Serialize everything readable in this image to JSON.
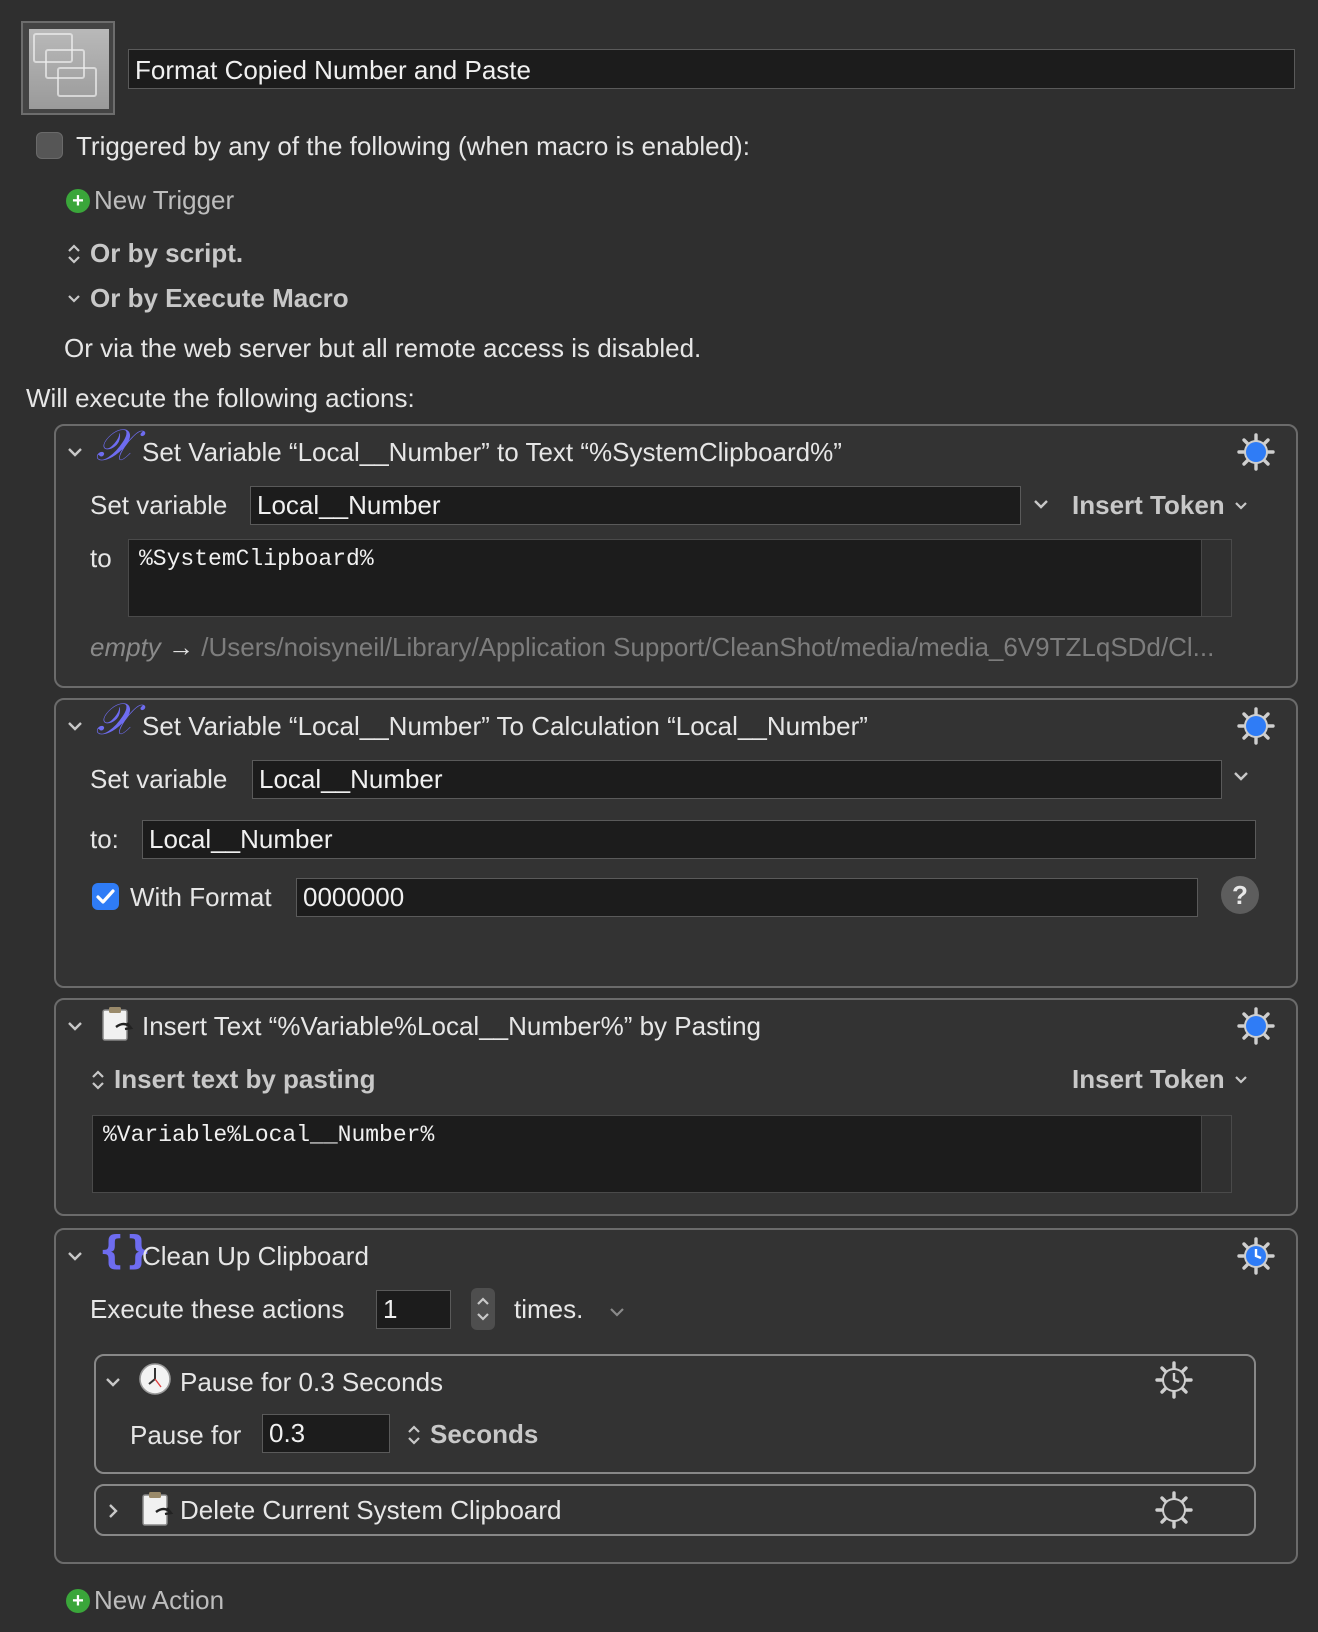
{
  "macro": {
    "name": "Format Copied Number and Paste",
    "trigger_label": "Triggered by any of the following (when macro is enabled):",
    "new_trigger": "New Trigger",
    "or_by_script": "Or by script.",
    "or_by_execute_macro": "Or by Execute Macro",
    "web_server_note": "Or via the web server but all remote access is disabled.",
    "will_execute": "Will execute the following actions:",
    "new_action": "New Action"
  },
  "actions": {
    "a1": {
      "title": "Set Variable “Local__Number” to Text “%SystemClipboard%”",
      "set_variable_label": "Set variable",
      "variable_value": "Local__Number",
      "insert_token": "Insert Token",
      "to_label": "to",
      "text_value": "%SystemClipboard%",
      "preview_empty": "empty",
      "preview_arrow": "→",
      "preview_path": "/Users/noisyneil/Library/Application Support/CleanShot/media/media_6V9TZLqSDd/Cl..."
    },
    "a2": {
      "title": "Set Variable “Local__Number” To Calculation “Local__Number”",
      "set_variable_label": "Set variable",
      "variable_value": "Local__Number",
      "to_label": "to:",
      "calc_value": "Local__Number",
      "with_format_label": "With Format",
      "with_format_checked": true,
      "format_value": "0000000",
      "help": "?"
    },
    "a3": {
      "title": "Insert Text “%Variable%Local__Number%” by Pasting",
      "mode_label": "Insert text by pasting",
      "insert_token": "Insert Token",
      "text_value": "%Variable%Local__Number%"
    },
    "a4": {
      "title": "Clean Up Clipboard",
      "execute_label": "Execute these actions",
      "times_value": "1",
      "times_label": "times.",
      "sub1": {
        "title": "Pause for 0.3 Seconds",
        "pause_label": "Pause for",
        "pause_value": "0.3",
        "unit": "Seconds"
      },
      "sub2": {
        "title": "Delete Current System Clipboard"
      }
    }
  },
  "colors": {
    "background": "#2f2f2f",
    "accent_blue": "#2f7cf6",
    "variable_icon": "#6e6cf0",
    "green_plus": "#3aa63a"
  }
}
